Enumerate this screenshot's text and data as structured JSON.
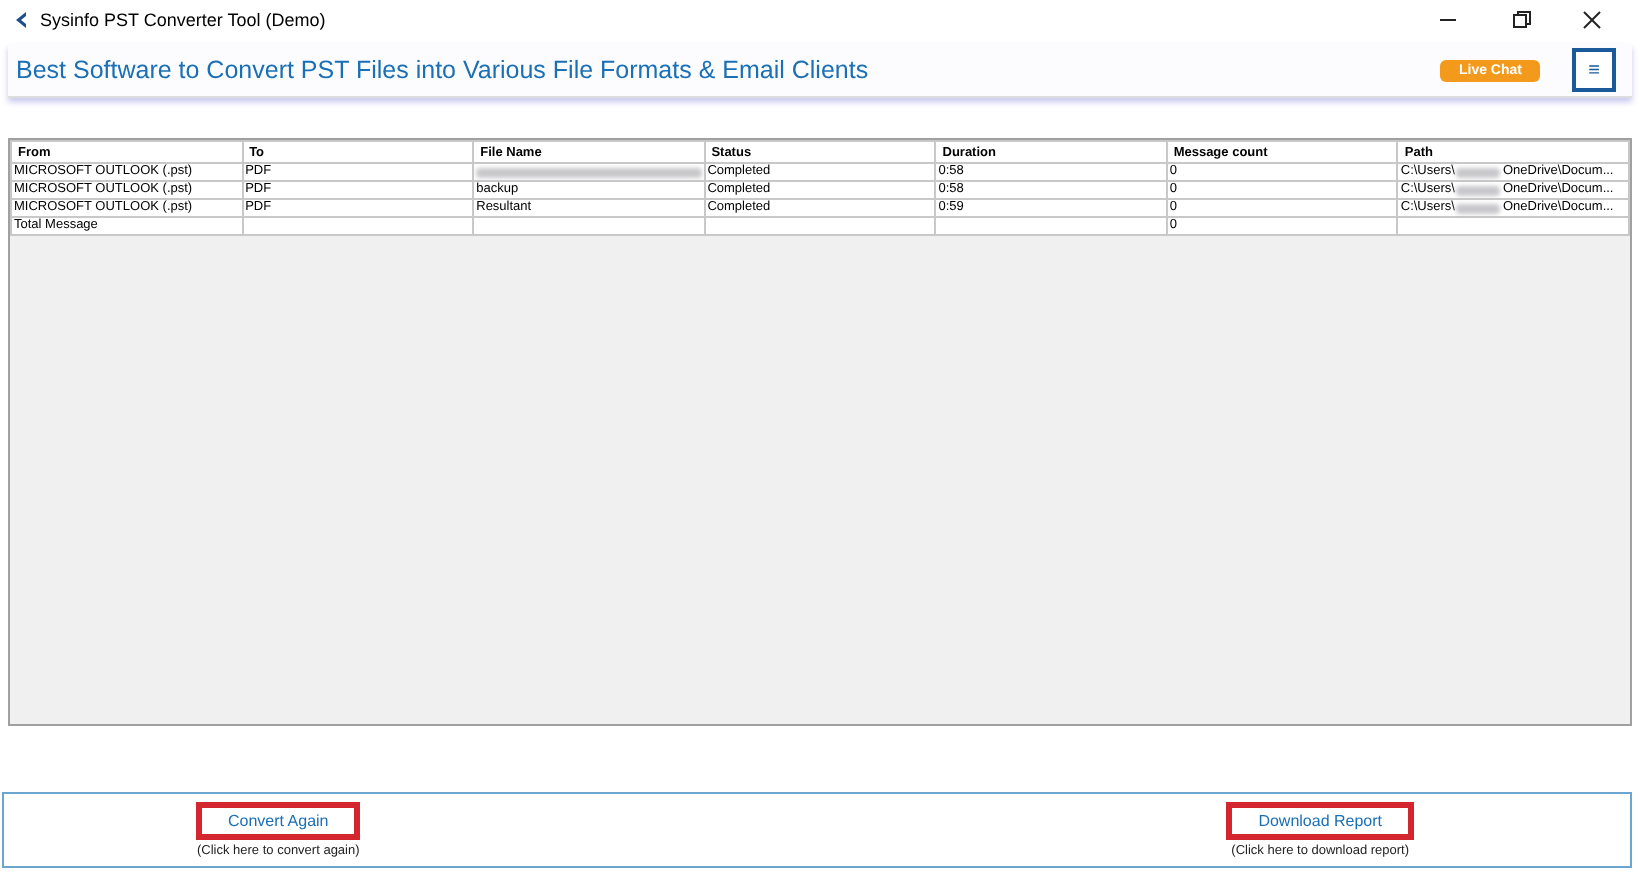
{
  "window": {
    "title": "Sysinfo PST Converter Tool (Demo)"
  },
  "header": {
    "headline": "Best Software to Convert PST Files into Various File Formats & Email Clients",
    "chat_button": "Live Chat",
    "menu_button": "≡"
  },
  "table": {
    "columns": [
      "From",
      "To",
      "File Name",
      "Status",
      "Duration",
      "Message count",
      "Path"
    ],
    "rows": [
      {
        "cells": [
          "MICROSOFT OUTLOOK (.pst)",
          "PDF",
          {
            "redacted": true
          },
          "Completed",
          "0:58",
          "0",
          {
            "redacted": true,
            "parts": [
              "C:\\Users\\",
              "OneDrive\\Docum..."
            ]
          }
        ]
      },
      {
        "cells": [
          "MICROSOFT OUTLOOK (.pst)",
          "PDF",
          "backup",
          "Completed",
          "0:58",
          "0",
          {
            "redacted": true,
            "parts": [
              "C:\\Users\\",
              "OneDrive\\Docum..."
            ]
          }
        ]
      },
      {
        "cells": [
          "MICROSOFT OUTLOOK (.pst)",
          "PDF",
          "Resultant",
          "Completed",
          "0:59",
          "0",
          {
            "redacted": true,
            "parts": [
              "C:\\Users\\",
              "OneDrive\\Docum..."
            ]
          }
        ]
      },
      {
        "cells": [
          "Total Message",
          "",
          "",
          "",
          "",
          "0",
          ""
        ]
      }
    ]
  },
  "actions": [
    {
      "label": "Convert Again",
      "hint": "(Click here to convert again)"
    },
    {
      "label": "Download Report",
      "hint": "(Click here to download report)"
    }
  ]
}
